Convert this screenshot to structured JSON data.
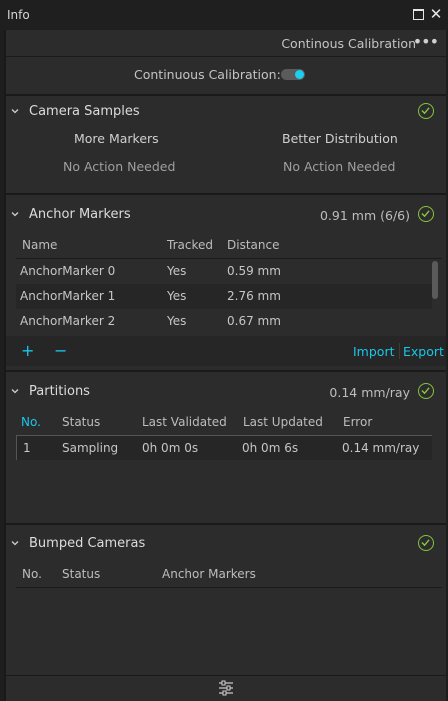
{
  "window": {
    "title": "Info"
  },
  "header": {
    "mode_label": "Continous Calibration",
    "more_menu": "•••"
  },
  "continuous_calibration": {
    "label": "Continuous Calibration:",
    "enabled": true
  },
  "camera_samples": {
    "title": "Camera Samples",
    "columns": [
      {
        "heading": "More Markers",
        "status": "No Action Needed"
      },
      {
        "heading": "Better Distribution",
        "status": "No Action Needed"
      }
    ]
  },
  "anchor_markers": {
    "title": "Anchor Markers",
    "summary": "0.91 mm (6/6)",
    "headers": {
      "name": "Name",
      "tracked": "Tracked",
      "distance": "Distance"
    },
    "rows": [
      {
        "name": "AnchorMarker 0",
        "tracked": "Yes",
        "distance": "0.59 mm"
      },
      {
        "name": "AnchorMarker 1",
        "tracked": "Yes",
        "distance": "2.76 mm"
      },
      {
        "name": "AnchorMarker 2",
        "tracked": "Yes",
        "distance": "0.67 mm"
      }
    ],
    "toolbar": {
      "add": "+",
      "remove": "−",
      "import": "Import",
      "export": "Export"
    }
  },
  "partitions": {
    "title": "Partitions",
    "summary": "0.14 mm/ray",
    "headers": {
      "no": "No.",
      "status": "Status",
      "last_validated": "Last Validated",
      "last_updated": "Last Updated",
      "error": "Error"
    },
    "rows": [
      {
        "no": "1",
        "status": "Sampling",
        "last_validated": "0h 0m 0s",
        "last_updated": "0h 0m 6s",
        "error": "0.14 mm/ray"
      }
    ]
  },
  "bumped_cameras": {
    "title": "Bumped Cameras",
    "headers": {
      "no": "No.",
      "status": "Status",
      "anchor_markers": "Anchor Markers"
    }
  },
  "colors": {
    "accent": "#17c7ea",
    "ok": "#86c440",
    "panel": "#2c2c2c",
    "background": "#1e1e1e"
  }
}
